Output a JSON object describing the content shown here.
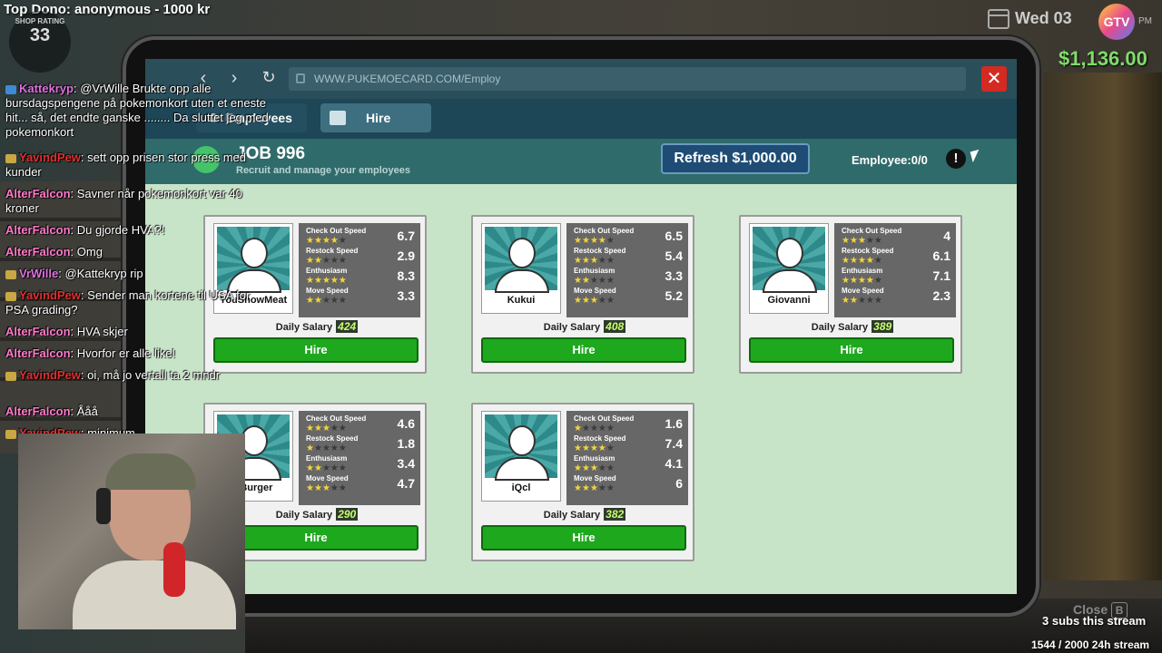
{
  "hud": {
    "top_dono": "Top Dono: anonymous - 1000 kr",
    "rating_label": "SHOP RATING",
    "rating_value": "33",
    "date": "Wed 03",
    "logo_text": "GTV",
    "time_suffix": "PM",
    "money": "$1,136.00"
  },
  "browser": {
    "url": "WWW.PUKEMOECARD.COM/Employ",
    "back_icon": "chevron-left-icon",
    "forward_icon": "chevron-right-icon",
    "refresh_icon": "reload-icon",
    "close_label": "✕"
  },
  "tabs": [
    {
      "label": "Employees",
      "icon": "employees-icon"
    },
    {
      "label": "Hire",
      "icon": "id-card-icon"
    }
  ],
  "header": {
    "title": "JOB 996",
    "subtitle": "Recruit and manage your employees",
    "refresh_label": "Refresh $1,000.00",
    "employee_count": "Employee:0/0",
    "info_label": "!"
  },
  "stat_labels": [
    "Check Out Speed",
    "Restock Speed",
    "Enthusiasm",
    "Move Speed"
  ],
  "candidates": [
    {
      "name": "YouShowMeat",
      "salary": "424",
      "stats": [
        {
          "value": "6.7",
          "stars": 4
        },
        {
          "value": "2.9",
          "stars": 2
        },
        {
          "value": "8.3",
          "stars": 5
        },
        {
          "value": "3.3",
          "stars": 2
        }
      ]
    },
    {
      "name": "Kukui",
      "salary": "408",
      "stats": [
        {
          "value": "6.5",
          "stars": 4
        },
        {
          "value": "5.4",
          "stars": 3
        },
        {
          "value": "3.3",
          "stars": 2
        },
        {
          "value": "5.2",
          "stars": 3
        }
      ]
    },
    {
      "name": "Giovanni",
      "salary": "389",
      "stats": [
        {
          "value": "4",
          "stars": 3
        },
        {
          "value": "6.1",
          "stars": 4
        },
        {
          "value": "7.1",
          "stars": 4
        },
        {
          "value": "2.3",
          "stars": 2
        }
      ]
    },
    {
      "name": "oBurger",
      "salary": "290",
      "stats": [
        {
          "value": "4.6",
          "stars": 3
        },
        {
          "value": "1.8",
          "stars": 1
        },
        {
          "value": "3.4",
          "stars": 2
        },
        {
          "value": "4.7",
          "stars": 3
        }
      ]
    },
    {
      "name": "iQcl",
      "salary": "382",
      "stats": [
        {
          "value": "1.6",
          "stars": 1
        },
        {
          "value": "7.4",
          "stars": 4
        },
        {
          "value": "4.1",
          "stars": 3
        },
        {
          "value": "6",
          "stars": 3
        }
      ]
    }
  ],
  "daily_salary_label": "Daily Salary",
  "hire_label": "Hire",
  "chat": [
    {
      "user": "Kattekryp",
      "text": "@VrWille Brukte opp alle bursdagspengene på pokemonkort uten et eneste hit... så, det endte ganske ........ Da sluttet jeg med pokemonkort",
      "color": "#e070e0",
      "badge": "crown"
    },
    {
      "user": "YavindPew",
      "text": "sett opp prisen stor press med kunder",
      "color": "#e03030",
      "badge": "sub"
    },
    {
      "user": "AlterFalcon",
      "text": "Savner når pokemonkort var 40 kroner",
      "color": "#ff7acb",
      "badge": ""
    },
    {
      "user": "AlterFalcon",
      "text": "Du gjorde HVA?!",
      "color": "#ff7acb",
      "badge": ""
    },
    {
      "user": "AlterFalcon",
      "text": "Omg",
      "color": "#ff7acb",
      "badge": ""
    },
    {
      "user": "VrWille",
      "text": "@Kattekryp rip",
      "color": "#e070e0",
      "badge": "sub"
    },
    {
      "user": "YavindPew",
      "text": "Sender man kortene til USA for PSA grading?",
      "color": "#e03030",
      "badge": "sub"
    },
    {
      "user": "AlterFalcon",
      "text": "HVA skjer",
      "color": "#ff7acb",
      "badge": ""
    },
    {
      "user": "AlterFalcon",
      "text": "Hvorfor er alle like!",
      "color": "#ff7acb",
      "badge": ""
    },
    {
      "user": "YavindPew",
      "text": "oi, må jo vertall ta 2 mndr",
      "color": "#e03030",
      "badge": "sub"
    },
    {
      "user": "AlterFalcon",
      "text": "Ååå",
      "color": "#ff7acb",
      "badge": ""
    },
    {
      "user": "YavindPew",
      "text": "minimum",
      "color": "#e03030",
      "badge": "sub"
    }
  ],
  "footer": {
    "close_hint": "Close",
    "close_key": "B",
    "subs": "3 subs this stream",
    "goal": "1544 / 2000 24h stream"
  }
}
